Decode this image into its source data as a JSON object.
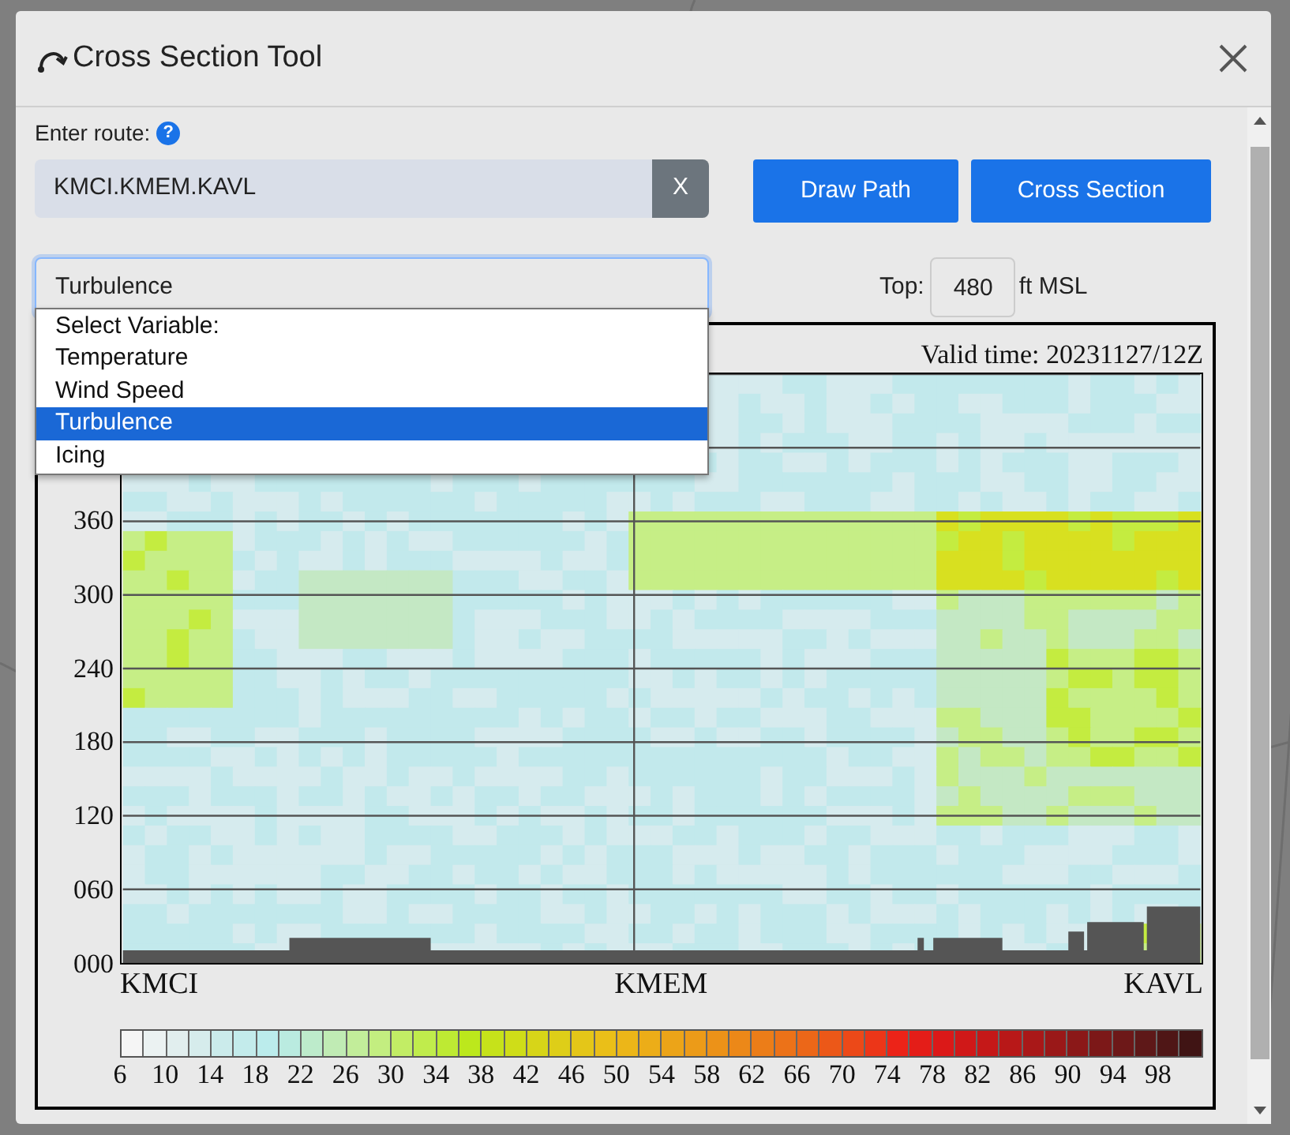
{
  "dialog": {
    "title": "Cross Section Tool"
  },
  "route": {
    "label": "Enter route:",
    "help": "?",
    "value": "KMCI.KMEM.KAVL",
    "clear": "X"
  },
  "buttons": [
    "Draw Path",
    "Cross Section"
  ],
  "variable": {
    "value": "Turbulence",
    "expanded": true,
    "options": [
      {
        "label": "Select Variable:",
        "selected": false
      },
      {
        "label": "Temperature",
        "selected": false
      },
      {
        "label": "Wind Speed",
        "selected": false
      },
      {
        "label": "Turbulence",
        "selected": true
      },
      {
        "label": "Icing",
        "selected": false
      }
    ]
  },
  "top": {
    "label": "Top:",
    "value": "480",
    "unit": "ft MSL"
  },
  "plot": {
    "valid_time": "Valid time: 20231127/12Z",
    "y_labels": [
      "360",
      "300",
      "240",
      "180",
      "120",
      "060",
      "000"
    ],
    "x_labels": [
      "KMCI",
      "KMEM",
      "KAVL"
    ],
    "colorbar_labels": [
      "6",
      "10",
      "14",
      "18",
      "22",
      "26",
      "30",
      "34",
      "38",
      "42",
      "46",
      "50",
      "54",
      "58",
      "62",
      "66",
      "70",
      "74",
      "78",
      "82",
      "86",
      "90",
      "94",
      "98"
    ]
  }
}
